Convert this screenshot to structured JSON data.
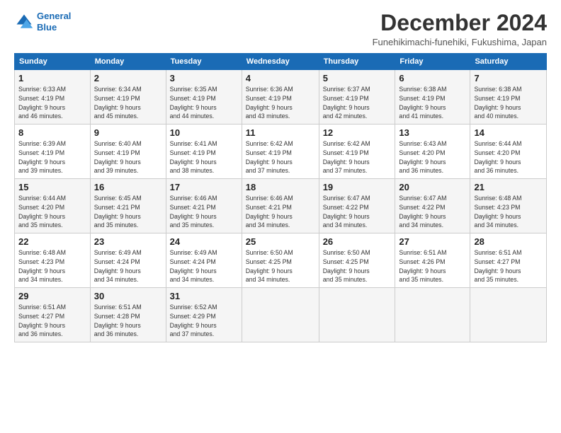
{
  "logo": {
    "line1": "General",
    "line2": "Blue"
  },
  "title": "December 2024",
  "subtitle": "Funehikimachi-funehiki, Fukushima, Japan",
  "days_of_week": [
    "Sunday",
    "Monday",
    "Tuesday",
    "Wednesday",
    "Thursday",
    "Friday",
    "Saturday"
  ],
  "weeks": [
    [
      {
        "day": "1",
        "info": "Sunrise: 6:33 AM\nSunset: 4:19 PM\nDaylight: 9 hours\nand 46 minutes."
      },
      {
        "day": "2",
        "info": "Sunrise: 6:34 AM\nSunset: 4:19 PM\nDaylight: 9 hours\nand 45 minutes."
      },
      {
        "day": "3",
        "info": "Sunrise: 6:35 AM\nSunset: 4:19 PM\nDaylight: 9 hours\nand 44 minutes."
      },
      {
        "day": "4",
        "info": "Sunrise: 6:36 AM\nSunset: 4:19 PM\nDaylight: 9 hours\nand 43 minutes."
      },
      {
        "day": "5",
        "info": "Sunrise: 6:37 AM\nSunset: 4:19 PM\nDaylight: 9 hours\nand 42 minutes."
      },
      {
        "day": "6",
        "info": "Sunrise: 6:38 AM\nSunset: 4:19 PM\nDaylight: 9 hours\nand 41 minutes."
      },
      {
        "day": "7",
        "info": "Sunrise: 6:38 AM\nSunset: 4:19 PM\nDaylight: 9 hours\nand 40 minutes."
      }
    ],
    [
      {
        "day": "8",
        "info": "Sunrise: 6:39 AM\nSunset: 4:19 PM\nDaylight: 9 hours\nand 39 minutes."
      },
      {
        "day": "9",
        "info": "Sunrise: 6:40 AM\nSunset: 4:19 PM\nDaylight: 9 hours\nand 39 minutes."
      },
      {
        "day": "10",
        "info": "Sunrise: 6:41 AM\nSunset: 4:19 PM\nDaylight: 9 hours\nand 38 minutes."
      },
      {
        "day": "11",
        "info": "Sunrise: 6:42 AM\nSunset: 4:19 PM\nDaylight: 9 hours\nand 37 minutes."
      },
      {
        "day": "12",
        "info": "Sunrise: 6:42 AM\nSunset: 4:19 PM\nDaylight: 9 hours\nand 37 minutes."
      },
      {
        "day": "13",
        "info": "Sunrise: 6:43 AM\nSunset: 4:20 PM\nDaylight: 9 hours\nand 36 minutes."
      },
      {
        "day": "14",
        "info": "Sunrise: 6:44 AM\nSunset: 4:20 PM\nDaylight: 9 hours\nand 36 minutes."
      }
    ],
    [
      {
        "day": "15",
        "info": "Sunrise: 6:44 AM\nSunset: 4:20 PM\nDaylight: 9 hours\nand 35 minutes."
      },
      {
        "day": "16",
        "info": "Sunrise: 6:45 AM\nSunset: 4:21 PM\nDaylight: 9 hours\nand 35 minutes."
      },
      {
        "day": "17",
        "info": "Sunrise: 6:46 AM\nSunset: 4:21 PM\nDaylight: 9 hours\nand 35 minutes."
      },
      {
        "day": "18",
        "info": "Sunrise: 6:46 AM\nSunset: 4:21 PM\nDaylight: 9 hours\nand 34 minutes."
      },
      {
        "day": "19",
        "info": "Sunrise: 6:47 AM\nSunset: 4:22 PM\nDaylight: 9 hours\nand 34 minutes."
      },
      {
        "day": "20",
        "info": "Sunrise: 6:47 AM\nSunset: 4:22 PM\nDaylight: 9 hours\nand 34 minutes."
      },
      {
        "day": "21",
        "info": "Sunrise: 6:48 AM\nSunset: 4:23 PM\nDaylight: 9 hours\nand 34 minutes."
      }
    ],
    [
      {
        "day": "22",
        "info": "Sunrise: 6:48 AM\nSunset: 4:23 PM\nDaylight: 9 hours\nand 34 minutes."
      },
      {
        "day": "23",
        "info": "Sunrise: 6:49 AM\nSunset: 4:24 PM\nDaylight: 9 hours\nand 34 minutes."
      },
      {
        "day": "24",
        "info": "Sunrise: 6:49 AM\nSunset: 4:24 PM\nDaylight: 9 hours\nand 34 minutes."
      },
      {
        "day": "25",
        "info": "Sunrise: 6:50 AM\nSunset: 4:25 PM\nDaylight: 9 hours\nand 34 minutes."
      },
      {
        "day": "26",
        "info": "Sunrise: 6:50 AM\nSunset: 4:25 PM\nDaylight: 9 hours\nand 35 minutes."
      },
      {
        "day": "27",
        "info": "Sunrise: 6:51 AM\nSunset: 4:26 PM\nDaylight: 9 hours\nand 35 minutes."
      },
      {
        "day": "28",
        "info": "Sunrise: 6:51 AM\nSunset: 4:27 PM\nDaylight: 9 hours\nand 35 minutes."
      }
    ],
    [
      {
        "day": "29",
        "info": "Sunrise: 6:51 AM\nSunset: 4:27 PM\nDaylight: 9 hours\nand 36 minutes."
      },
      {
        "day": "30",
        "info": "Sunrise: 6:51 AM\nSunset: 4:28 PM\nDaylight: 9 hours\nand 36 minutes."
      },
      {
        "day": "31",
        "info": "Sunrise: 6:52 AM\nSunset: 4:29 PM\nDaylight: 9 hours\nand 37 minutes."
      },
      {
        "day": "",
        "info": ""
      },
      {
        "day": "",
        "info": ""
      },
      {
        "day": "",
        "info": ""
      },
      {
        "day": "",
        "info": ""
      }
    ]
  ]
}
